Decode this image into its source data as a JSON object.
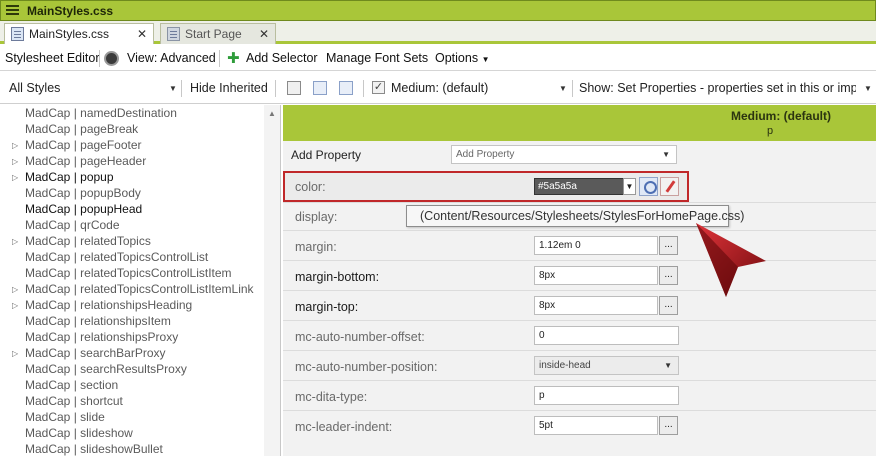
{
  "window": {
    "title": "MainStyles.css"
  },
  "tabs": [
    {
      "label": "MainStyles.css",
      "close": "✕"
    },
    {
      "label": "Start Page",
      "close": "✕"
    }
  ],
  "toolbar": {
    "stylesheet_editor": "Stylesheet Editor",
    "view": "View: Advanced",
    "add_selector": "Add Selector",
    "manage_font_sets": "Manage Font Sets",
    "options": "Options"
  },
  "filter": {
    "styles_dropdown": "All Styles",
    "hide_inherited": "Hide Inherited",
    "medium_checked": true,
    "medium_dropdown": "Medium: (default)",
    "show_dropdown": "Show: Set Properties - properties set in this or imported"
  },
  "tree": [
    {
      "label": "MadCap | namedDestination",
      "expandable": false,
      "dark": false
    },
    {
      "label": "MadCap | pageBreak",
      "expandable": false,
      "dark": false
    },
    {
      "label": "MadCap | pageFooter",
      "expandable": true,
      "dark": false
    },
    {
      "label": "MadCap | pageHeader",
      "expandable": true,
      "dark": false
    },
    {
      "label": "MadCap | popup",
      "expandable": true,
      "dark": true
    },
    {
      "label": "MadCap | popupBody",
      "expandable": false,
      "dark": false
    },
    {
      "label": "MadCap | popupHead",
      "expandable": false,
      "dark": true
    },
    {
      "label": "MadCap | qrCode",
      "expandable": false,
      "dark": false
    },
    {
      "label": "MadCap | relatedTopics",
      "expandable": true,
      "dark": false
    },
    {
      "label": "MadCap | relatedTopicsControlList",
      "expandable": false,
      "dark": false
    },
    {
      "label": "MadCap | relatedTopicsControlListItem",
      "expandable": false,
      "dark": false
    },
    {
      "label": "MadCap | relatedTopicsControlListItemLink",
      "expandable": true,
      "dark": false
    },
    {
      "label": "MadCap | relationshipsHeading",
      "expandable": true,
      "dark": false
    },
    {
      "label": "MadCap | relationshipsItem",
      "expandable": false,
      "dark": false
    },
    {
      "label": "MadCap | relationshipsProxy",
      "expandable": false,
      "dark": false
    },
    {
      "label": "MadCap | searchBarProxy",
      "expandable": true,
      "dark": false
    },
    {
      "label": "MadCap | searchResultsProxy",
      "expandable": false,
      "dark": false
    },
    {
      "label": "MadCap | section",
      "expandable": false,
      "dark": false
    },
    {
      "label": "MadCap | shortcut",
      "expandable": false,
      "dark": false
    },
    {
      "label": "MadCap | slide",
      "expandable": false,
      "dark": false
    },
    {
      "label": "MadCap | slideshow",
      "expandable": false,
      "dark": false
    },
    {
      "label": "MadCap | slideshowBullet",
      "expandable": false,
      "dark": false
    }
  ],
  "right_header": {
    "medium": "Medium: (default)",
    "selector": "p"
  },
  "add_property": {
    "label": "Add Property",
    "placeholder": "Add Property"
  },
  "properties": {
    "color": {
      "name": "color:",
      "value": "#5a5a5a"
    },
    "display": {
      "name": "display:"
    },
    "margin": {
      "name": "margin:",
      "value": "1.12em 0"
    },
    "margin_bottom": {
      "name": "margin-bottom:",
      "value": "8px"
    },
    "margin_top": {
      "name": "margin-top:",
      "value": "8px"
    },
    "mc_auto_number_offset": {
      "name": "mc-auto-number-offset:",
      "value": "0"
    },
    "mc_auto_number_position": {
      "name": "mc-auto-number-position:",
      "value": "inside-head"
    },
    "mc_dita_type": {
      "name": "mc-dita-type:",
      "value": "p"
    },
    "mc_leader_indent": {
      "name": "mc-leader-indent:",
      "value": "5pt"
    }
  },
  "tooltip": "(Content/Resources/Stylesheets/StylesForHomePage.css)",
  "dots_label": "...",
  "colors": {
    "accent": "#a9c639",
    "highlight": "#c0282a",
    "swatch": "#5a5a5a"
  }
}
